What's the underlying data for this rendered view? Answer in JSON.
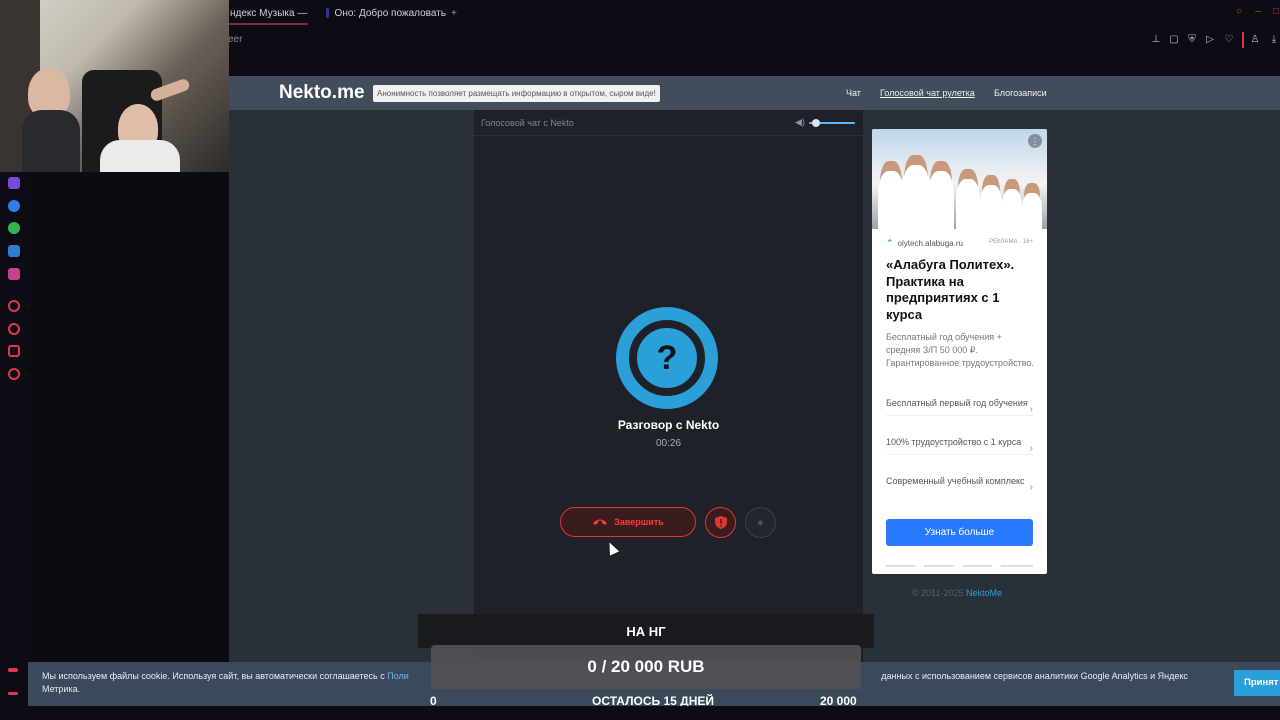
{
  "browser": {
    "tabs": [
      {
        "label": "ндекс Музыка — со"
      },
      {
        "label": "Оно: Добро пожаловать"
      }
    ],
    "new_tab": "+",
    "address_fragment": "eer"
  },
  "site": {
    "logo": "Nekto.me",
    "tagline": "Анонимность позволяет размещать информацию в открытом, сыром виде!",
    "nav": [
      "Чат",
      "Голосовой чат рулетка",
      "Блогозаписи"
    ]
  },
  "chat": {
    "header_title": "Голосовой чат с Nekto",
    "volume_level": 0.15,
    "avatar_symbol": "?",
    "peer_name": "Разговор с Nekto",
    "timer": "00:26",
    "end_button_label": "Завершить",
    "accent_color": "#2a9fd8",
    "danger_color": "#e3362e"
  },
  "ad": {
    "domain": "olytech.alabuga.ru",
    "disclaimer": "РЕКЛАМА · 16+",
    "title": "«Алабуга Политех». Практика на предприятиях с 1 курса",
    "description": "Бесплатный год обучения + средняя З/П 50 000 ₽. Гарантированное трудоустройство.",
    "links": [
      "Бесплатный первый год обучения",
      "100% трудоустройство с 1 курса",
      "Современный учебный комплекс"
    ],
    "button": "Узнать больше"
  },
  "footer": {
    "copyright": "© 2011-2025",
    "brand_link": "NektoMe"
  },
  "cookie": {
    "text_before": "Мы используем файлы cookie. Используя сайт, вы автоматически соглашаетесь с ",
    "link": "Поли",
    "text_after": " данных с использованием сервисов аналитики Google Analytics и Яндекс Метрика.",
    "accept": "Принят"
  },
  "donation": {
    "title": "НА НГ",
    "amount": "0 / 20 000 RUB",
    "min": "0",
    "remaining": "ОСТАЛОСЬ 15 ДНЕЙ",
    "max": "20 000"
  }
}
